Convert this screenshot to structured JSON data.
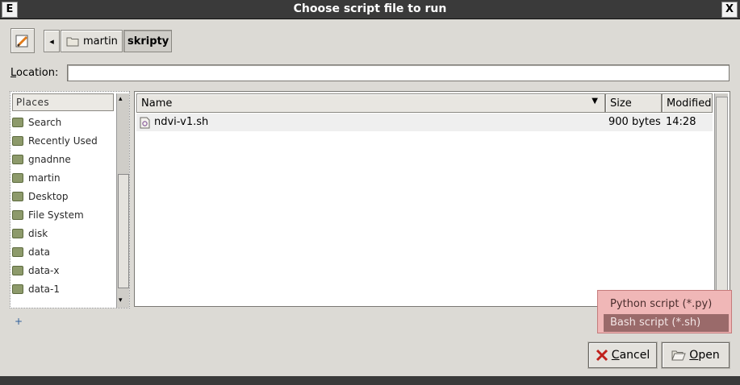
{
  "window": {
    "app_letter": "E",
    "title": "Choose script file to run",
    "close_glyph": "X"
  },
  "pathbar": {
    "back_arrow": "◂",
    "crumbs": [
      {
        "label": "martin",
        "icon": "folder-icon"
      },
      {
        "label": "skripty",
        "active": true
      }
    ]
  },
  "location": {
    "label_prefix": "",
    "label_mnemonic": "L",
    "label_rest": "ocation:",
    "value": ""
  },
  "places": {
    "header": "Places",
    "items": [
      {
        "label": "Search",
        "icon": "search-icon"
      },
      {
        "label": "Recently Used",
        "icon": "recent-icon"
      },
      {
        "label": "gnadnne",
        "icon": "home-folder-icon"
      },
      {
        "label": "martin",
        "icon": "folder-icon"
      },
      {
        "label": "Desktop",
        "icon": "desktop-icon"
      },
      {
        "label": "File System",
        "icon": "drive-icon"
      },
      {
        "label": "disk",
        "icon": "drive-icon"
      },
      {
        "label": "data",
        "icon": "drive-icon"
      },
      {
        "label": "data-x",
        "icon": "drive-icon"
      },
      {
        "label": "data-1",
        "icon": "drive-icon"
      }
    ],
    "add_label": "+"
  },
  "file_list": {
    "columns": {
      "name": "Name",
      "size": "Size",
      "modified": "Modified"
    },
    "rows": [
      {
        "name": "ndvi-v1.sh",
        "size": "900 bytes",
        "modified": "14:28",
        "icon": "script-file-icon"
      }
    ]
  },
  "filter": {
    "options": [
      "Python script (*.py)",
      "Bash script (*.sh)"
    ],
    "selected_index": 1,
    "colors": {
      "popup_bg": "#f0b7b7",
      "selected_bg": "#9a6a6a",
      "selected_fg": "#f4e6e6"
    }
  },
  "actions": {
    "cancel": {
      "mnemonic": "C",
      "rest": "ancel"
    },
    "open": {
      "mnemonic": "O",
      "rest": "pen"
    }
  }
}
